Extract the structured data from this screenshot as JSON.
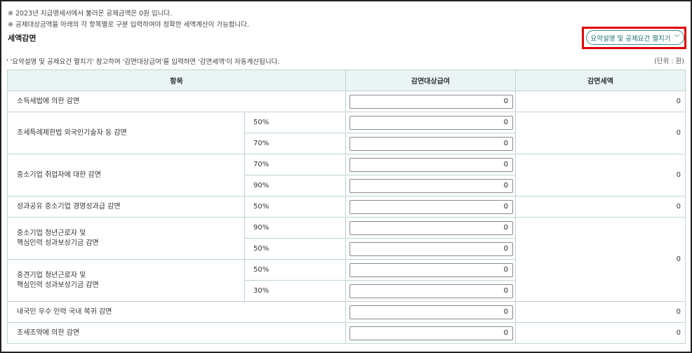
{
  "notes": {
    "line1": "※ 2023년 지급명세서에서 불러온 공제금액은 0원 입니다.",
    "line2": "※ 공제대상금액을 아래의 각 항목별로 구분 입력하여야 정확한 세액계산이 가능합니다."
  },
  "section_title": "세액감면",
  "toggle_button": {
    "label": "요약설명 및 공제요건 펼치기",
    "icon": "chevron-down-icon"
  },
  "highlight_color": "#e00000",
  "guide_text": "' '요약설명 및 공제요건 펼치기' 참고하여 '감면대상급여'를 입력하면 '감면세액'이 자동계산됩니다.",
  "unit_text": "(단위 : 원)",
  "table": {
    "headers": {
      "item": "항목",
      "target": "감면대상급여",
      "amount": "감면세액"
    },
    "rows": [
      {
        "item": "소득세법에 의한 감면",
        "inputs": [
          "0"
        ],
        "result": "0"
      },
      {
        "item": "조세특례제한법 외국인기술자 등 감면",
        "pcts": [
          "50%",
          "70%"
        ],
        "inputs": [
          "0",
          "0"
        ],
        "result": "0"
      },
      {
        "item": "중소기업 취업자에 대한 감면",
        "pcts": [
          "70%",
          "90%"
        ],
        "inputs": [
          "0",
          "0"
        ],
        "result": "0"
      },
      {
        "item": "성과공유 중소기업 경영성과급 감면",
        "pcts": [
          "50%"
        ],
        "inputs": [
          "0"
        ],
        "result": "0"
      },
      {
        "item_line1": "중소기업 청년근로자 및",
        "item_line2": "핵심인력 성과보상기금 감면",
        "pcts": [
          "90%",
          "50%"
        ],
        "inputs": [
          "0",
          "0"
        ]
      },
      {
        "item_line1": "중견기업 청년근로자 및",
        "item_line2": "핵심인력 성과보상기금 감면",
        "pcts": [
          "50%",
          "30%"
        ],
        "inputs": [
          "0",
          "0"
        ]
      },
      {
        "item": "내국인 우수 인력 국내 복귀 감면",
        "inputs": [
          "0"
        ],
        "result": "0"
      },
      {
        "item": "조세조약에 의한 감면",
        "inputs": [
          "0"
        ],
        "result": "0"
      }
    ],
    "merged_result": "0"
  }
}
